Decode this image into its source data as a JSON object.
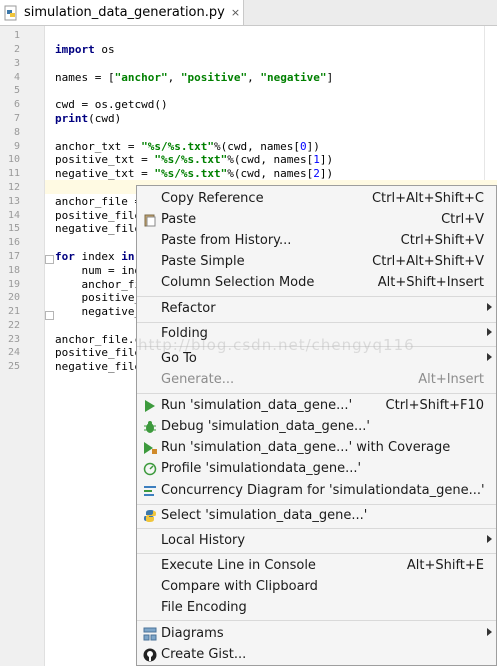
{
  "tab": {
    "title": "simulation_data_generation.py",
    "close": "×",
    "icon": "python-file-icon"
  },
  "editor": {
    "line_numbers": [
      "1",
      "2",
      "3",
      "4",
      "5",
      "6",
      "7",
      "8",
      "9",
      "10",
      "11",
      "12",
      "13",
      "14",
      "15",
      "16",
      "17",
      "18",
      "19",
      "20",
      "21",
      "22",
      "23",
      "24",
      "25"
    ],
    "code": {
      "l3": "import os",
      "l5": "names = [\"anchor\", \"positive\", \"negative\"]",
      "l7": "cwd = os.getcwd()",
      "l8": "print(cwd)",
      "l10": "anchor_txt = \"%s/%s.txt\"%(cwd, names[0])",
      "l11": "positive_txt = \"%s/%s.txt\"%(cwd, names[1])",
      "l12": "negative_txt = \"%s/%s.txt\"%(cwd, names[2])",
      "l14": "anchor_file =",
      "l15": "positive_file",
      "l16": "negative_file",
      "l18": "for index in",
      "l19": "    num = ind",
      "l20": "    anchor_fi",
      "l21": "    positive_",
      "l22": "    negative_",
      "l24": "anchor_file.c",
      "l25": "positive_file",
      "l26": "negative_file"
    }
  },
  "context_menu": {
    "items": {
      "copy_reference": {
        "label": "Copy Reference",
        "shortcut": "Ctrl+Alt+Shift+C"
      },
      "paste": {
        "label": "Paste",
        "shortcut": "Ctrl+V",
        "icon": "clipboard-icon"
      },
      "paste_history": {
        "label": "Paste from History...",
        "shortcut": "Ctrl+Shift+V"
      },
      "paste_simple": {
        "label": "Paste Simple",
        "shortcut": "Ctrl+Alt+Shift+V"
      },
      "column_selection": {
        "label": "Column Selection Mode",
        "shortcut": "Alt+Shift+Insert"
      },
      "refactor": {
        "label": "Refactor"
      },
      "folding": {
        "label": "Folding"
      },
      "go_to": {
        "label": "Go To"
      },
      "generate": {
        "label": "Generate...",
        "shortcut": "Alt+Insert"
      },
      "run": {
        "label": "Run 'simulation_data_gene...'",
        "shortcut": "Ctrl+Shift+F10",
        "icon": "run-icon"
      },
      "debug": {
        "label": "Debug 'simulation_data_gene...'",
        "icon": "debug-icon"
      },
      "run_coverage": {
        "label": "Run 'simulation_data_gene...' with Coverage",
        "icon": "coverage-icon"
      },
      "profile": {
        "label": "Profile 'simulationdata_gene...'",
        "icon": "profile-icon"
      },
      "concurrency": {
        "label": "Concurrency Diagram for  'simulationdata_gene...'",
        "icon": "concurrency-icon"
      },
      "select": {
        "label": "Select 'simulation_data_gene...'",
        "icon": "python-icon"
      },
      "local_history": {
        "label": "Local History"
      },
      "execute_console": {
        "label": "Execute Line in Console",
        "shortcut": "Alt+Shift+E"
      },
      "compare_clipboard": {
        "label": "Compare with Clipboard"
      },
      "file_encoding": {
        "label": "File Encoding"
      },
      "diagrams": {
        "label": "Diagrams",
        "icon": "diagram-icon"
      },
      "create_gist": {
        "label": "Create Gist...",
        "icon": "github-icon"
      }
    }
  },
  "watermark": "http://blog.csdn.net/chengyq116",
  "colors": {
    "keyword": "#000080",
    "string": "#008000",
    "number": "#0000ff",
    "menu_bg": "#f5f5f5"
  }
}
